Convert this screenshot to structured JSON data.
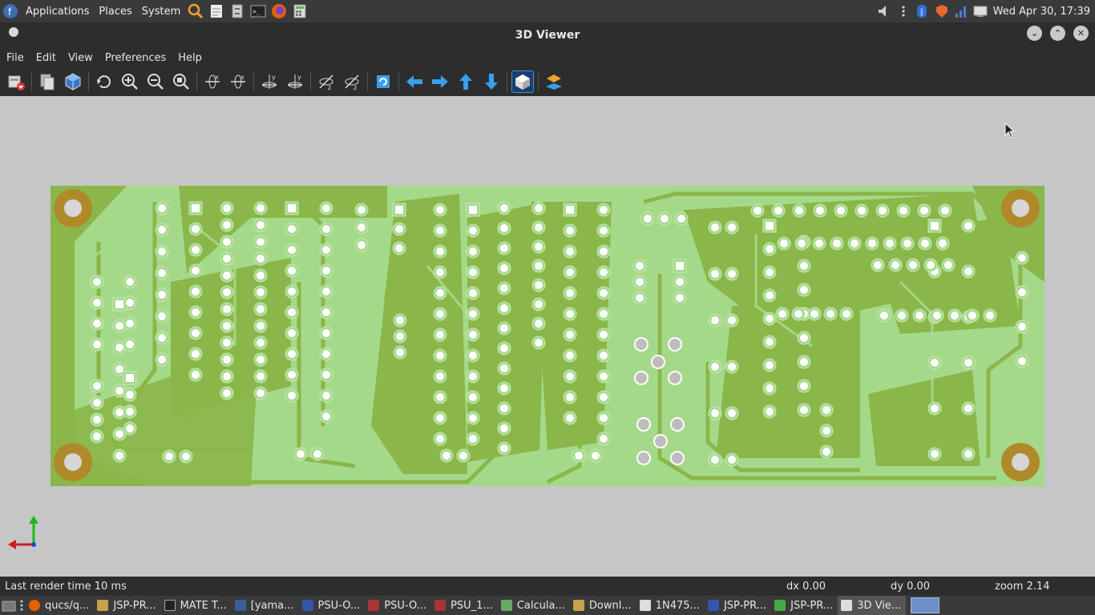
{
  "top_panel": {
    "menus": [
      "Applications",
      "Places",
      "System"
    ],
    "clock": "Wed Apr 30, 17:39"
  },
  "window": {
    "title": "3D Viewer"
  },
  "menubar": [
    "File",
    "Edit",
    "View",
    "Preferences",
    "Help"
  ],
  "toolbar": {
    "icons": [
      "export-icon",
      "copy-icon",
      "board-3d-icon",
      "reload-icon",
      "zoom-in-icon",
      "zoom-out-icon",
      "zoom-fit-icon",
      "rotate-x-cw-icon",
      "rotate-x-ccw-icon",
      "rotate-y-cw-icon",
      "rotate-y-ccw-icon",
      "rotate-z-cw-icon",
      "rotate-z-ccw-icon",
      "flip-board-icon",
      "move-left-icon",
      "move-right-icon",
      "move-up-icon",
      "move-down-icon",
      "orthographic-icon",
      "layers-icon"
    ]
  },
  "colors": {
    "board_light": "#a5d98a",
    "board_dark": "#8ab64a",
    "copper_hole": "#b08a2a",
    "canvas": "#c6c6c6"
  },
  "status": {
    "render_time": "Last render time 10 ms",
    "dx": "dx 0.00",
    "dy": "dy 0.00",
    "zoom": "zoom 2.14"
  },
  "taskbar": [
    {
      "label": "qucs/q...",
      "color": "#c7a24a"
    },
    {
      "label": "JSP-PR...",
      "color": "#c7a24a"
    },
    {
      "label": "MATE T...",
      "color": "#444"
    },
    {
      "label": "[yama...",
      "color": "#3a5e9a"
    },
    {
      "label": "PSU-O...",
      "color": "#3355aa"
    },
    {
      "label": "PSU-O...",
      "color": "#a33"
    },
    {
      "label": "PSU_1...",
      "color": "#a33"
    },
    {
      "label": "Calcula...",
      "color": "#6a6"
    },
    {
      "label": "Downl...",
      "color": "#c7a24a"
    },
    {
      "label": "1N475...",
      "color": "#ddd"
    },
    {
      "label": "JSP-PR...",
      "color": "#3355aa"
    },
    {
      "label": "JSP-PR...",
      "color": "#4a4"
    },
    {
      "label": "3D Vie...",
      "color": "#ddd"
    }
  ]
}
